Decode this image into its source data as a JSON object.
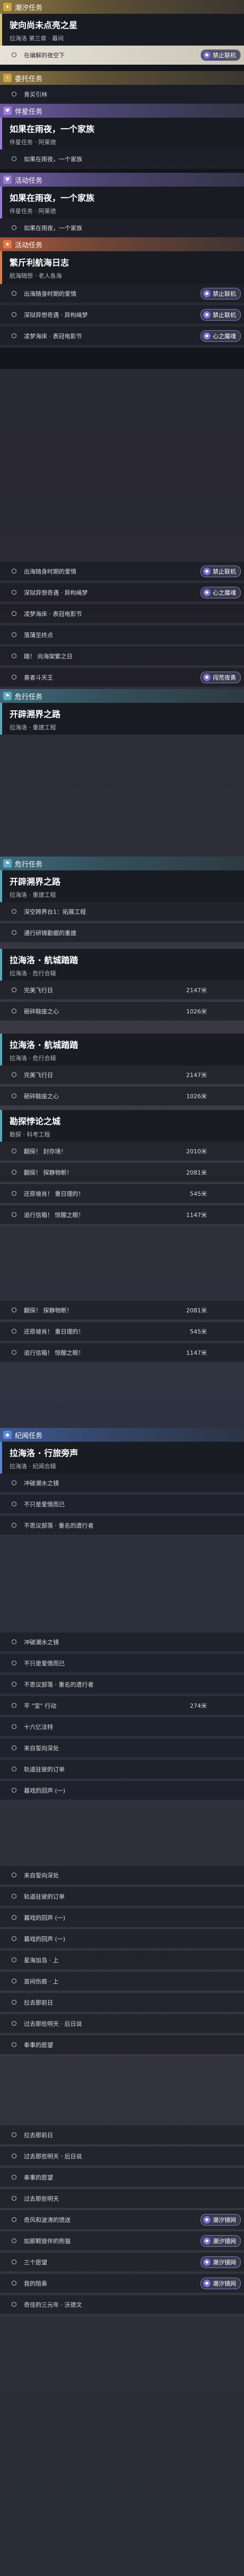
{
  "sections": {
    "tide": "潮汐任务",
    "daily": "委托任务",
    "companion": "伴星任务",
    "event": "活动任务",
    "hunt": "危行任务",
    "story": "纪闻任务"
  },
  "tide_quest": {
    "title": "驶向尚未点亮之星",
    "sub": "拉海洛 第三章 · 暮间",
    "step": "在编解的夜空下",
    "badge": "禁止联机"
  },
  "daily_step": "青买引林",
  "companion_quest": {
    "title": "如果在雨夜，一个家族",
    "sub": "伴星任务 · 阿莱德",
    "step": "如果在雨夜，一个家族"
  },
  "event_quest": {
    "title": "如果在雨夜，一个家族",
    "sub": "伴星任务 · 阿莱德",
    "step": "如果在雨夜，一个家族"
  },
  "seaside": {
    "title": "繁斤利航海日志",
    "sub": "航海随想 · 老人各海",
    "items": [
      "出海随身时期的爱情",
      "深狱异想奇遇 · 异构绳梦",
      "凌梦海床 · 表冠电影节"
    ],
    "badges": [
      "禁止联机",
      "禁止联机",
      "心之魔魂"
    ]
  },
  "seaside2": {
    "items": [
      "出海随身时期的爱情",
      "深狱异想奇遇 · 异构绳梦",
      "凌梦海床 · 表冠电影节",
      "落蒲至终点",
      "踏！ 向海架繁之日",
      "善者斗天王"
    ],
    "badges": [
      "禁止联机",
      "心之魔魂",
      "闯荒夜勇"
    ]
  },
  "hunt_quest": {
    "title": "开辟溯界之路",
    "sub": "拉海洛 · 重建工程"
  },
  "hunt2_quest": {
    "title": "开辟溯界之路",
    "sub": "拉海洛 · 重建工程",
    "items": [
      "深空跨界台1：拓展工程",
      "通行研锦勤据的重建"
    ]
  },
  "lahailuo": {
    "title": "拉海洛 · 航城踏踏",
    "sub": "拉海洛 · 危行合辑",
    "items": [
      [
        "完美飞行日",
        "2147米"
      ],
      [
        "砸碎鞍座之心",
        "1026米"
      ]
    ]
  },
  "lahailuo2": {
    "title": "拉海洛 · 航城踏踏",
    "sub": "拉海洛 · 危行合辑",
    "items": [
      [
        "完美飞行日",
        "2147米"
      ],
      [
        "砸碎鞍座之心",
        "1026米"
      ]
    ]
  },
  "ruins": {
    "title": "勘探悖论之城",
    "sub": "勘探 · 科考工程",
    "items": [
      [
        "翻探！ 封存境！",
        "2010米"
      ],
      [
        "翻探！ 探静物断！",
        "2081米"
      ],
      [
        "还原坡肖！ 重日理的！",
        "545米"
      ],
      [
        "追行信箱！ 惊醒之眼！",
        "1147米"
      ]
    ]
  },
  "ruins2": {
    "items": [
      [
        "翻探！ 探静物断！",
        "2081米"
      ],
      [
        "还原坡肖！ 重日理的！",
        "545米"
      ],
      [
        "追行信箱！ 惊醒之眼！",
        "1147米"
      ]
    ]
  },
  "story_quest": {
    "title": "拉海洛 · 行旅旁声",
    "sub": "拉海洛 · 纪闻合辑",
    "items": [
      "冲破潮水之镜",
      "不只是爱情而已",
      "不思议部落 · 重名的遗行者"
    ]
  },
  "story2": {
    "items": [
      "冲破潮水之镜",
      "不只是爱情而已",
      "不思议部落 · 重名的遗行者",
      "平 \"宝\" 行动",
      "十六亿法特",
      "来自誓向深处",
      "轨道驻驶的订单",
      "暮戏的回声 (一)"
    ],
    "dist": "274米"
  },
  "story3": {
    "items": [
      "来自誓向深处",
      "轨道驻驶的订单",
      "暮戏的回声 (一)",
      "暮戏的回声 (一)",
      "星海加岛 · 上",
      "苗间伤痕 · 上",
      "拉去那前日",
      "过去那些明天 · 后日说",
      "奉事的愿望"
    ]
  },
  "story4": {
    "items": [
      "拉去那前日",
      "过去那些明天 · 后日说",
      "奉事的愿望",
      "过去那些明天",
      "奇风和波涛的馈送",
      "如那颗旅伴的熊猫",
      "三个愿望",
      "我的陪奏",
      "奇佳的三元年 · 沃德文"
    ],
    "badges": [
      "潮汐镜网",
      "潮汐镜网",
      "潮汐镜网",
      "潮汐镜网"
    ]
  }
}
